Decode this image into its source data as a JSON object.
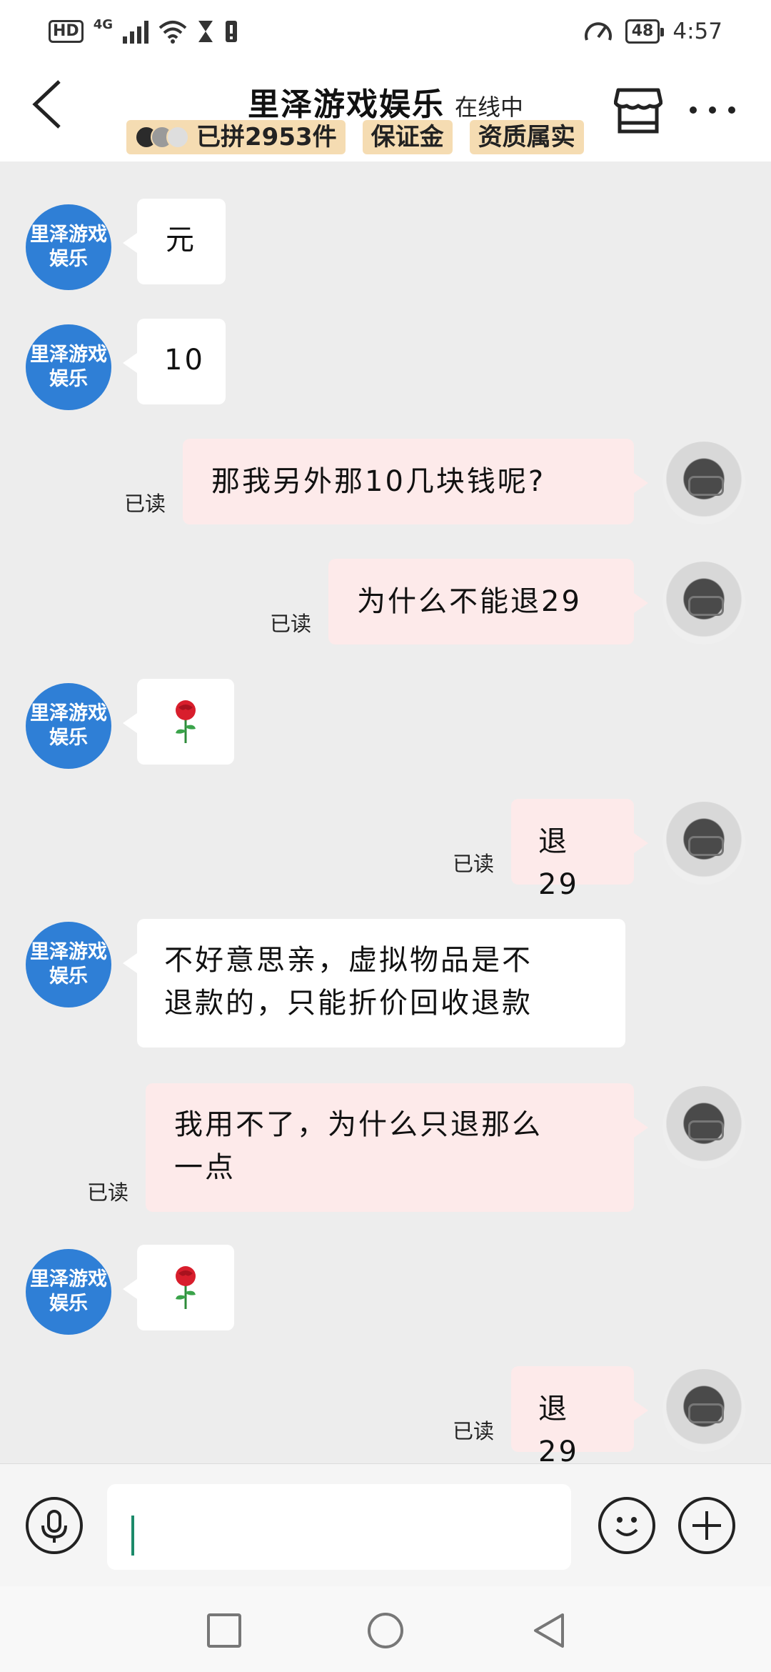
{
  "status_bar": {
    "hd": "HD",
    "network": "4G",
    "battery": "48",
    "time": "4:57"
  },
  "header": {
    "title": "里泽游戏娱乐",
    "status": "在线中",
    "badges": [
      "已拼2953件",
      "保证金",
      "资质属实"
    ],
    "icons": [
      "back-arrow-icon",
      "store-icon",
      "more-dots-icon"
    ]
  },
  "shop_avatar": {
    "line1": "里泽游戏",
    "line2": "娱乐",
    "color": "#2f7fd6"
  },
  "read_label": "已读",
  "messages": [
    {
      "side": "in",
      "text": "元"
    },
    {
      "side": "in",
      "text": "10"
    },
    {
      "side": "out",
      "text": "那我另外那10几块钱呢?",
      "read": true
    },
    {
      "side": "out",
      "text": "为什么不能退29",
      "read": true
    },
    {
      "side": "in",
      "icon": "rose-emoji-icon"
    },
    {
      "side": "out",
      "text": "退29",
      "read": true
    },
    {
      "side": "in",
      "lines": [
        "不好意思亲，虚拟物品是不",
        "退款的，只能折价回收退款"
      ]
    },
    {
      "side": "out",
      "lines": [
        "我用不了，为什么只退那么",
        "一点"
      ],
      "read": true
    },
    {
      "side": "in",
      "icon": "rose-emoji-icon"
    },
    {
      "side": "out",
      "text": "退29",
      "read": true
    }
  ],
  "input_bar": {
    "value": "",
    "icons": [
      "microphone-icon",
      "emoji-icon",
      "plus-icon"
    ],
    "caret_color": "#1c8a6a"
  },
  "nav_bar": {
    "icons": [
      "recents-square-icon",
      "home-circle-icon",
      "back-triangle-icon"
    ]
  },
  "colors": {
    "incoming_bubble": "#ffffff",
    "outgoing_bubble": "#fdeaea",
    "badge": "#f5dcb2",
    "chat_bg": "#ededed"
  }
}
